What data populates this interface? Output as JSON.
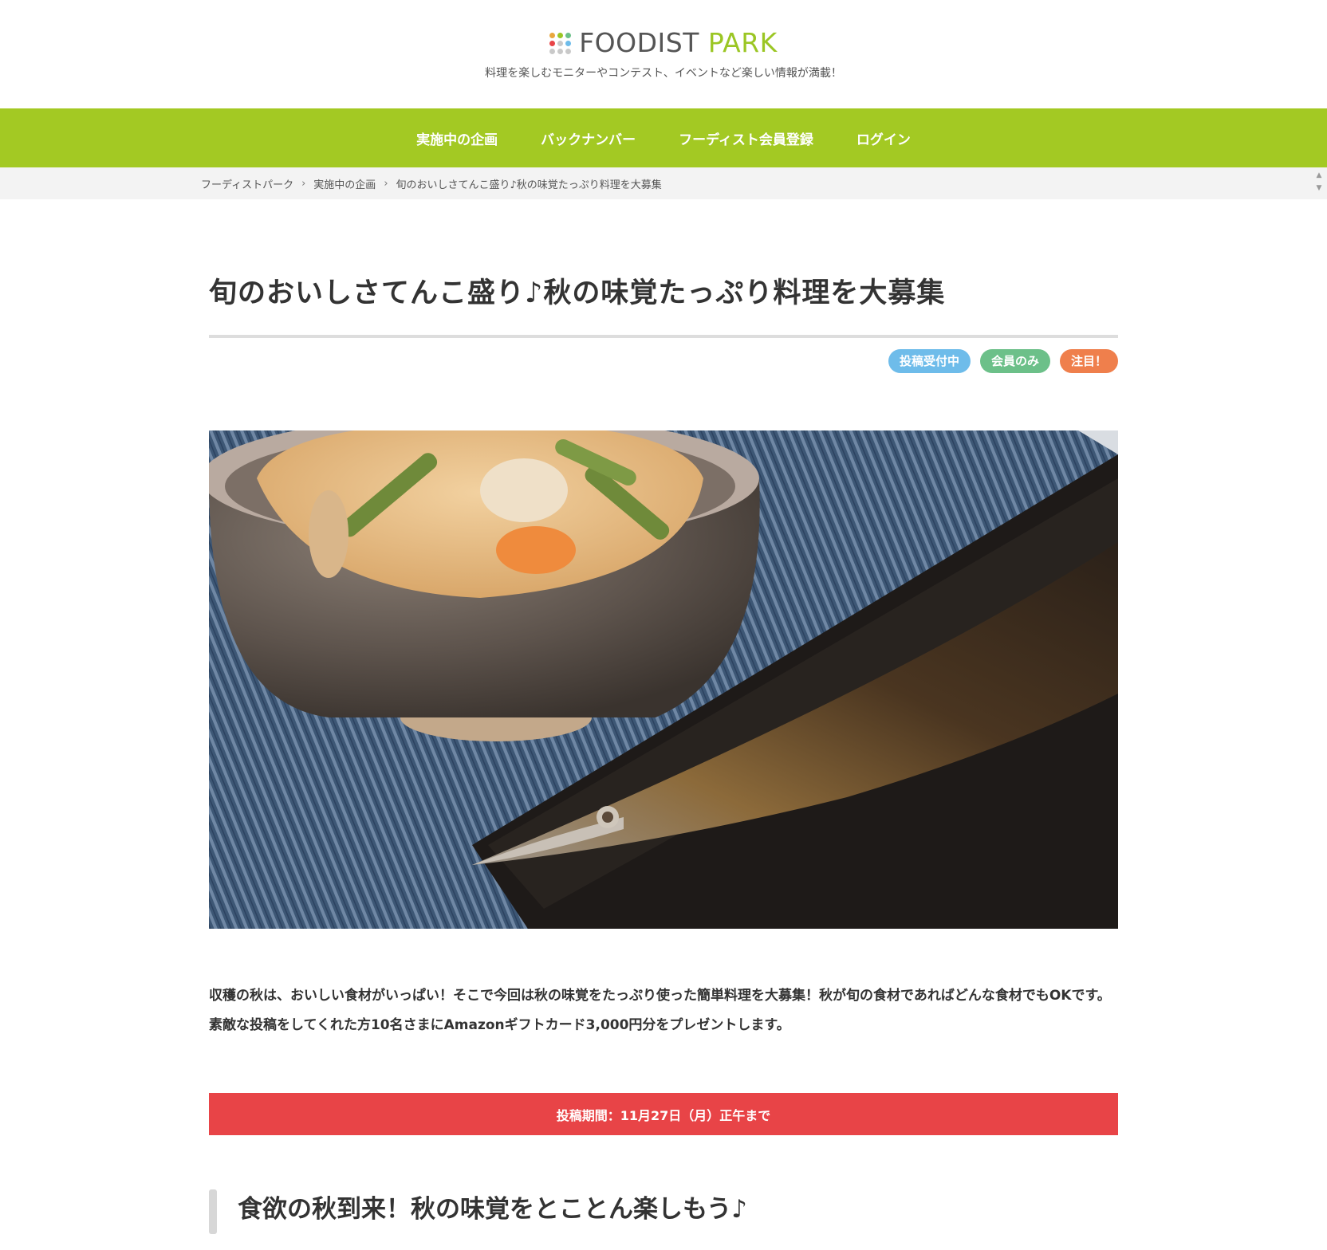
{
  "header": {
    "logo_word1": "FOODIST",
    "logo_word2": " PARK",
    "tagline": "料理を楽しむモニターやコンテスト、イベントなど楽しい情報が満載！",
    "logo_dot_colors": [
      "#e9a73d",
      "#9bc624",
      "#6cc089",
      "#e84447",
      "#c9c9c9",
      "#6ebcea",
      "#c9c9c9",
      "#c9c9c9",
      "#c9c9c9"
    ]
  },
  "nav": {
    "items": [
      {
        "label": "実施中の企画"
      },
      {
        "label": "バックナンバー"
      },
      {
        "label": "フーディスト会員登録"
      },
      {
        "label": "ログイン"
      }
    ],
    "bg_color": "#a3c923"
  },
  "breadcrumb": {
    "items": [
      "フーディストパーク",
      "実施中の企画",
      "旬のおいしさてんこ盛り♪秋の味覚たっぷり料理を大募集"
    ],
    "separator": "›"
  },
  "article": {
    "title": "旬のおいしさてんこ盛り♪秋の味覚たっぷり料理を大募集",
    "badges": [
      {
        "label": "投稿受付中",
        "color": "#6ebcea"
      },
      {
        "label": "会員のみ",
        "color": "#6cc089"
      },
      {
        "label": "注目！",
        "color": "#ef7f4c"
      }
    ],
    "intro": "収穫の秋は、おいしい食材がいっぱい！そこで今回は秋の味覚をたっぷり使った簡単料理を大募集！秋が旬の食材であればどんな食材でもOKです。素敵な投稿をしてくれた方10名さまにAmazonギフトカード3,000円分をプレゼントします。",
    "period": "投稿期間：11月27日（月）正午まで",
    "section_heading": "食欲の秋到来！秋の味覚をとことん楽しもう♪"
  }
}
